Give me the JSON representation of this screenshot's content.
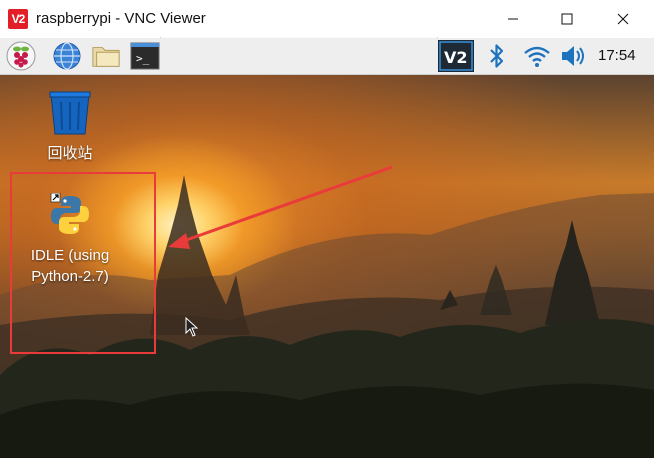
{
  "window": {
    "title": "raspberrypi - VNC Viewer",
    "app_icon": "vnc-logo-icon",
    "logo_text": "V2",
    "controls": [
      "minimize-icon",
      "maximize-icon",
      "close-icon"
    ]
  },
  "panel": {
    "launchers": [
      "raspberry-menu-icon",
      "web-browser-icon",
      "file-manager-icon",
      "terminal-icon"
    ],
    "tray": [
      "vnc-server-icon",
      "bluetooth-icon",
      "wifi-icon",
      "volume-icon"
    ],
    "vnc_tray_text": "V2",
    "terminal_prompt": ">_",
    "clock": "17:54",
    "accent": "#1e73be"
  },
  "desktop": {
    "icons": [
      {
        "label": "回收站",
        "icon": "trash-icon"
      },
      {
        "label_lines": [
          "IDLE (using",
          "Python-2.7)"
        ],
        "icon": "python-icon"
      }
    ],
    "annotation_color": "#ea3b3b"
  }
}
